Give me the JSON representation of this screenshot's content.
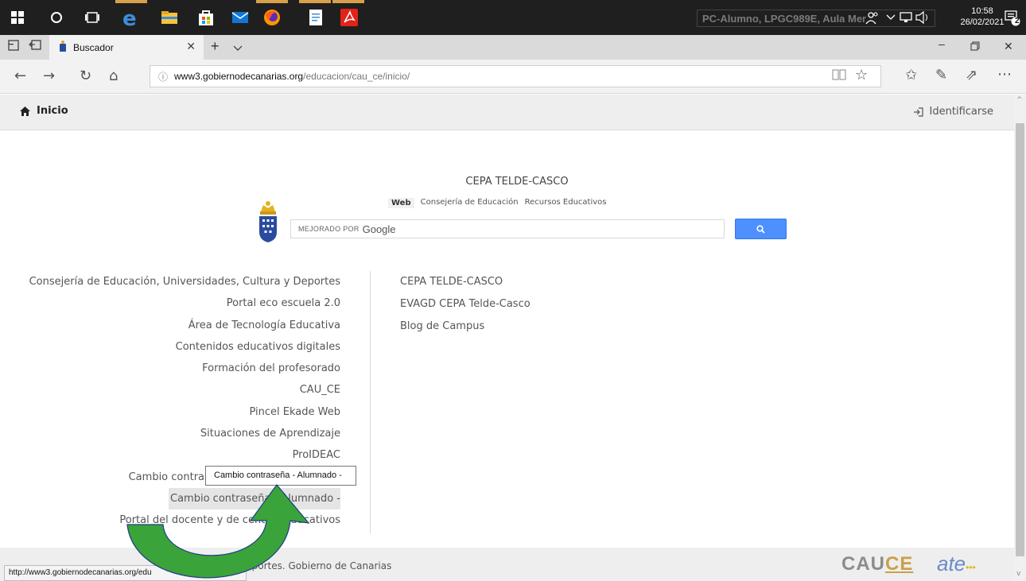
{
  "taskbar": {
    "pc_label": "PC-Alumno, LPGC989E, Aula Mer",
    "time": "10:58",
    "date": "26/02/2021",
    "notifications": "2"
  },
  "browser": {
    "tab_title": "Buscador",
    "url_host": "www3.gobiernodecanarias.org",
    "url_path": "/educacion/cau_ce/inicio/"
  },
  "header": {
    "home_label": "Inicio",
    "login_label": "Identificarse"
  },
  "main": {
    "title": "CEPA TELDE-CASCO",
    "search_tabs": [
      "Web",
      "Consejería de Educación",
      "Recursos Educativos"
    ],
    "search_enhanced": "MEJORADO POR",
    "search_brand": "Google",
    "left_links": [
      "Consejería de Educación, Universidades, Cultura y Deportes",
      "Portal eco escuela 2.0",
      "Área de Tecnología Educativa",
      "Contenidos educativos digitales",
      "Formación del profesorado",
      "CAU_CE",
      "Pincel Ekade Web",
      "Situaciones de Aprendizaje",
      "ProIDEAC",
      "Cambio contraseña",
      "Cambio contraseña - Alumnado -",
      "Portal del docente y de centros educativos"
    ],
    "right_links": [
      "CEPA TELDE-CASCO",
      "EVAGD CEPA Telde-Casco",
      "Blog de Campus"
    ],
    "tooltip": "Cambio contraseña - Alumnado -"
  },
  "footer": {
    "text": "Deportes.  Gobierno de Canarias",
    "logo_cau": "CAU",
    "logo_ce": "CE",
    "logo_ate": "ate"
  },
  "status_url": "http://www3.gobiernodecanarias.org/edu",
  "colors": {
    "accent_blue": "#4d90fe",
    "arrow_green": "#3aa33a",
    "arrow_outline": "#1f3c8a"
  }
}
